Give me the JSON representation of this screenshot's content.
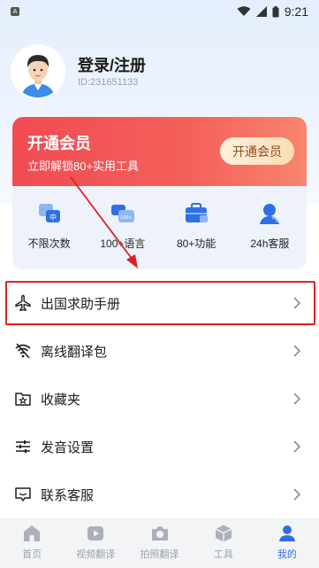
{
  "status_bar": {
    "time": "9:21",
    "left_icon_letter": "A"
  },
  "profile": {
    "login_label": "登录/注册",
    "user_id": "ID:231651133"
  },
  "vip": {
    "title": "开通会员",
    "subtitle": "立即解锁80+实用工具",
    "button_label": "开通会员",
    "benefits": [
      {
        "label": "不限次数",
        "icon": "translate-icon"
      },
      {
        "label": "100+语言",
        "icon": "language-icon"
      },
      {
        "label": "80+功能",
        "icon": "toolbox-icon"
      },
      {
        "label": "24h客服",
        "icon": "support-icon"
      }
    ]
  },
  "menu": [
    {
      "label": "出国求助手册",
      "icon": "airplane-icon"
    },
    {
      "label": "离线翻译包",
      "icon": "offline-wifi-icon"
    },
    {
      "label": "收藏夹",
      "icon": "star-folder-icon"
    },
    {
      "label": "发音设置",
      "icon": "sliders-icon"
    },
    {
      "label": "联系客服",
      "icon": "chat-icon"
    }
  ],
  "bottom_nav": [
    {
      "label": "首页",
      "icon": "home-icon",
      "active": false
    },
    {
      "label": "视频翻译",
      "icon": "video-icon",
      "active": false
    },
    {
      "label": "拍照翻译",
      "icon": "camera-icon",
      "active": false
    },
    {
      "label": "工具",
      "icon": "box-icon",
      "active": false
    },
    {
      "label": "我的",
      "icon": "person-icon",
      "active": true
    }
  ],
  "colors": {
    "accent": "#2f6fe4",
    "vip_red": "#f14b52",
    "highlight": "#e02020"
  }
}
